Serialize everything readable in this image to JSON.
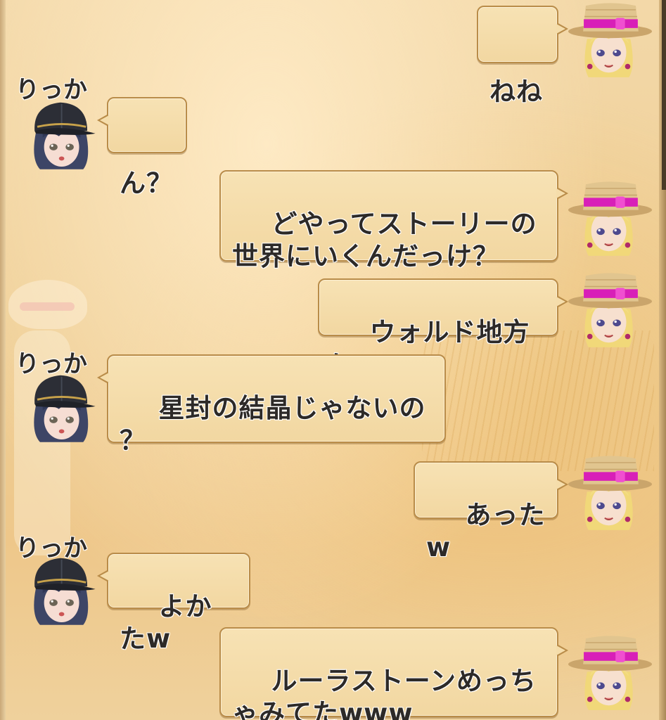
{
  "speakers": {
    "friend": {
      "name": "りっか"
    },
    "self": {
      "name": ""
    }
  },
  "messages": [
    {
      "from": "self",
      "text": "ねね"
    },
    {
      "from": "friend",
      "text": "ん？"
    },
    {
      "from": "self",
      "text": "どやってストーリーの\n世界にいくんだっけ？"
    },
    {
      "from": "self",
      "text": "ウォルド地方に"
    },
    {
      "from": "friend",
      "text": "星封の結晶じゃないの\n？"
    },
    {
      "from": "self",
      "text": "あったw"
    },
    {
      "from": "friend",
      "text": "よかたw"
    },
    {
      "from": "self",
      "text": "ルーラストーンめっち\nゃみてたwww"
    }
  ],
  "icons": {
    "friend_avatar": "black-cap-girl-avatar-icon",
    "self_avatar": "straw-hat-girl-avatar-icon"
  },
  "colors": {
    "bubble_fill": "#f5ddab",
    "bubble_border": "#b98c49",
    "text": "#2d2a28",
    "hat_band": "#d81fb8"
  }
}
